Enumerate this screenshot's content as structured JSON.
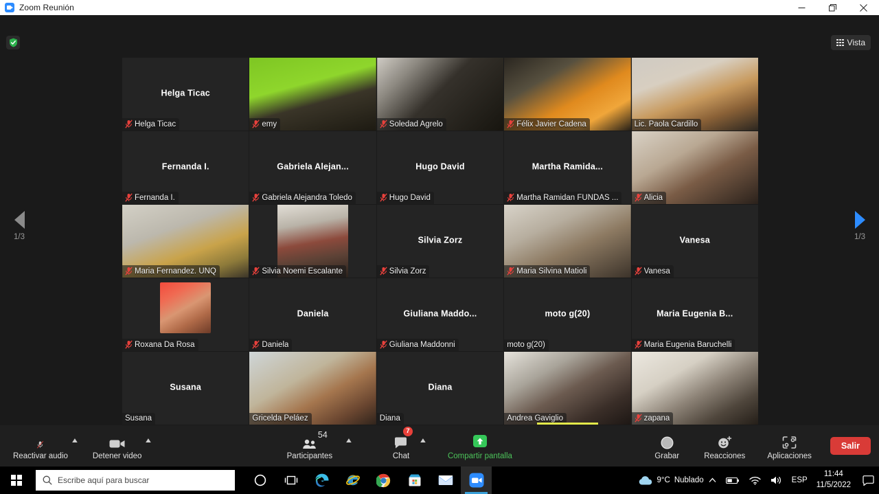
{
  "window": {
    "title": "Zoom Reunión",
    "logo_icon": "zoom-logo-icon",
    "minimize_icon": "minimize-icon",
    "maximize_icon": "maximize-icon",
    "close_icon": "close-icon"
  },
  "topbar": {
    "shield_icon": "shield-check-icon",
    "view_label": "Vista",
    "view_icon": "grid-icon"
  },
  "gallery": {
    "tiles": [
      {
        "center_name": "Helga Ticac",
        "plate_name": "Helga Ticac",
        "muted": true,
        "video": false,
        "media": "none"
      },
      {
        "center_name": "",
        "plate_name": "emy",
        "muted": true,
        "video": true,
        "media": "video-green-room"
      },
      {
        "center_name": "",
        "plate_name": "Soledad Agrelo",
        "muted": true,
        "video": true,
        "media": "video-dark-room"
      },
      {
        "center_name": "",
        "plate_name": "Félix Javier Cadena",
        "muted": true,
        "video": true,
        "media": "video-orange-shirt"
      },
      {
        "center_name": "",
        "plate_name": "Lic. Paola Cardillo",
        "muted": false,
        "video": true,
        "media": "video-woman-glasses",
        "active_speaker": true
      },
      {
        "center_name": "Fernanda I.",
        "plate_name": "Fernanda I.",
        "muted": true,
        "video": false,
        "media": "none"
      },
      {
        "center_name": "Gabriela  Alejan...",
        "plate_name": "Gabriela Alejandra Toledo",
        "muted": true,
        "video": false,
        "media": "none"
      },
      {
        "center_name": "Hugo David",
        "plate_name": "Hugo David",
        "muted": true,
        "video": false,
        "media": "none"
      },
      {
        "center_name": "Martha  Ramida...",
        "plate_name": "Martha Ramidan FUNDAS ...",
        "muted": true,
        "video": false,
        "media": "none"
      },
      {
        "center_name": "",
        "plate_name": "Alicia",
        "muted": true,
        "video": true,
        "media": "video-woman-painting"
      },
      {
        "center_name": "",
        "plate_name": "Maria Fernandez. UNQ",
        "muted": true,
        "video": true,
        "media": "video-classroom"
      },
      {
        "center_name": "",
        "plate_name": "Silvia Noemi Escalante",
        "muted": true,
        "video": true,
        "media": "video-bookshelf-portrait",
        "aspect": "portrait"
      },
      {
        "center_name": "Silvia Zorz",
        "plate_name": "Silvia Zorz",
        "muted": true,
        "video": false,
        "media": "none"
      },
      {
        "center_name": "",
        "plate_name": "Maria Silvina Matioli",
        "muted": true,
        "video": true,
        "media": "video-woman-wall"
      },
      {
        "center_name": "Vanesa",
        "plate_name": "Vanesa",
        "muted": true,
        "video": false,
        "media": "none"
      },
      {
        "center_name": "",
        "plate_name": "Roxana Da Rosa",
        "muted": true,
        "video": false,
        "media": "avatar-baby-photo",
        "aspect": "avatar"
      },
      {
        "center_name": "Daniela",
        "plate_name": "Daniela",
        "muted": true,
        "video": false,
        "media": "none"
      },
      {
        "center_name": "Giuliana  Maddo...",
        "plate_name": "Giuliana Maddonni",
        "muted": true,
        "video": false,
        "media": "none"
      },
      {
        "center_name": "moto g(20)",
        "plate_name": "moto g(20)",
        "muted": false,
        "video": false,
        "media": "none"
      },
      {
        "center_name": "Maria  Eugenia  B...",
        "plate_name": "Maria Eugenia Baruchelli",
        "muted": true,
        "video": false,
        "media": "none"
      },
      {
        "center_name": "Susana",
        "plate_name": "Susana",
        "muted": false,
        "video": false,
        "media": "none"
      },
      {
        "center_name": "",
        "plate_name": "Gricelda Peláez",
        "muted": false,
        "video": true,
        "media": "video-woman-kitchen"
      },
      {
        "center_name": "Diana",
        "plate_name": "Diana",
        "muted": false,
        "video": false,
        "media": "none"
      },
      {
        "center_name": "",
        "plate_name": "Andrea Gaviglio",
        "muted": false,
        "video": true,
        "media": "video-woman-window",
        "speaking": true
      },
      {
        "center_name": "",
        "plate_name": "zapana",
        "muted": true,
        "video": true,
        "media": "video-man-curtains"
      }
    ]
  },
  "pager": {
    "prev_icon": "chevron-left-icon",
    "prev_label": "1/3",
    "next_icon": "chevron-right-icon",
    "next_label": "1/3"
  },
  "toolbar": {
    "audio": {
      "label": "Reactivar audio",
      "icon": "microphone-muted-icon",
      "caret": "▲"
    },
    "video": {
      "label": "Detener video",
      "icon": "camera-icon",
      "caret": "▲"
    },
    "participants": {
      "label": "Participantes",
      "icon": "people-icon",
      "count": "54",
      "caret": "▲"
    },
    "chat": {
      "label": "Chat",
      "icon": "chat-bubble-icon",
      "badge": "7",
      "caret": "▲"
    },
    "share": {
      "label": "Compartir pantalla",
      "icon": "share-screen-icon"
    },
    "record": {
      "label": "Grabar",
      "icon": "record-circle-icon"
    },
    "reactions": {
      "label": "Reacciones",
      "icon": "smiley-plus-icon"
    },
    "apps": {
      "label": "Aplicaciones",
      "icon": "apps-bracket-icon"
    },
    "leave": {
      "label": "Salir"
    }
  },
  "taskbar": {
    "start_icon": "windows-start-icon",
    "search_placeholder": "Escribe aquí para buscar",
    "search_icon": "search-icon",
    "apps": [
      {
        "name": "cortana-icon"
      },
      {
        "name": "task-view-icon"
      },
      {
        "name": "edge-icon"
      },
      {
        "name": "internet-explorer-icon"
      },
      {
        "name": "chrome-icon"
      },
      {
        "name": "microsoft-store-icon"
      },
      {
        "name": "mail-icon"
      },
      {
        "name": "zoom-taskbar-icon",
        "active": true
      }
    ],
    "weather": {
      "icon": "cloud-icon",
      "temp": "9°C",
      "condition": "Nublado"
    },
    "tray": {
      "chevron_icon": "chevron-up-icon",
      "battery_icon": "battery-icon",
      "wifi_icon": "wifi-icon",
      "volume_icon": "volume-icon",
      "language": "ESP",
      "notifications_icon": "notifications-icon"
    },
    "clock": {
      "time": "11:44",
      "date": "11/5/2022"
    }
  },
  "colors": {
    "accent_blue": "#2d8cff",
    "active_speaker": "#cfe548",
    "leave_red": "#d93b37",
    "share_green": "#4cc35a",
    "badge_red": "#e8403a",
    "muted_red": "#e8413c"
  }
}
